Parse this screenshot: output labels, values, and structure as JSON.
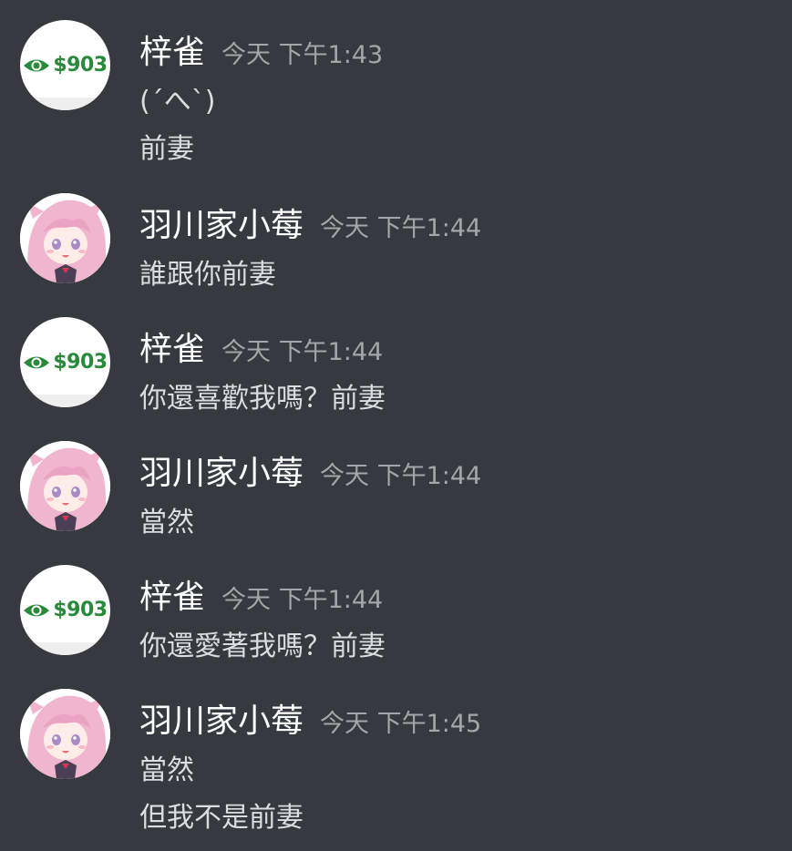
{
  "messages": [
    {
      "username": "梓雀",
      "timestamp": "今天 下午1:43",
      "avatar_type": "eye-price",
      "avatar_text": "$903",
      "lines": [
        "(ˊへˋ)",
        "前妻"
      ]
    },
    {
      "username": "羽川家小莓",
      "timestamp": "今天 下午1:44",
      "avatar_type": "anime-girl",
      "lines": [
        "誰跟你前妻"
      ]
    },
    {
      "username": "梓雀",
      "timestamp": "今天 下午1:44",
      "avatar_type": "eye-price",
      "avatar_text": "$903",
      "lines": [
        "你還喜歡我嗎？前妻"
      ]
    },
    {
      "username": "羽川家小莓",
      "timestamp": "今天 下午1:44",
      "avatar_type": "anime-girl",
      "lines": [
        "當然"
      ]
    },
    {
      "username": "梓雀",
      "timestamp": "今天 下午1:44",
      "avatar_type": "eye-price",
      "avatar_text": "$903",
      "lines": [
        "你還愛著我嗎？前妻"
      ]
    },
    {
      "username": "羽川家小莓",
      "timestamp": "今天 下午1:45",
      "avatar_type": "anime-girl",
      "lines": [
        "當然",
        "但我不是前妻"
      ]
    }
  ],
  "colors": {
    "background": "#36393f",
    "username": "#ffffff",
    "timestamp": "#a3a6aa",
    "message_text": "#dcddde",
    "price_green": "#2a8a3b",
    "anime_hair": "#f1b6cf"
  }
}
